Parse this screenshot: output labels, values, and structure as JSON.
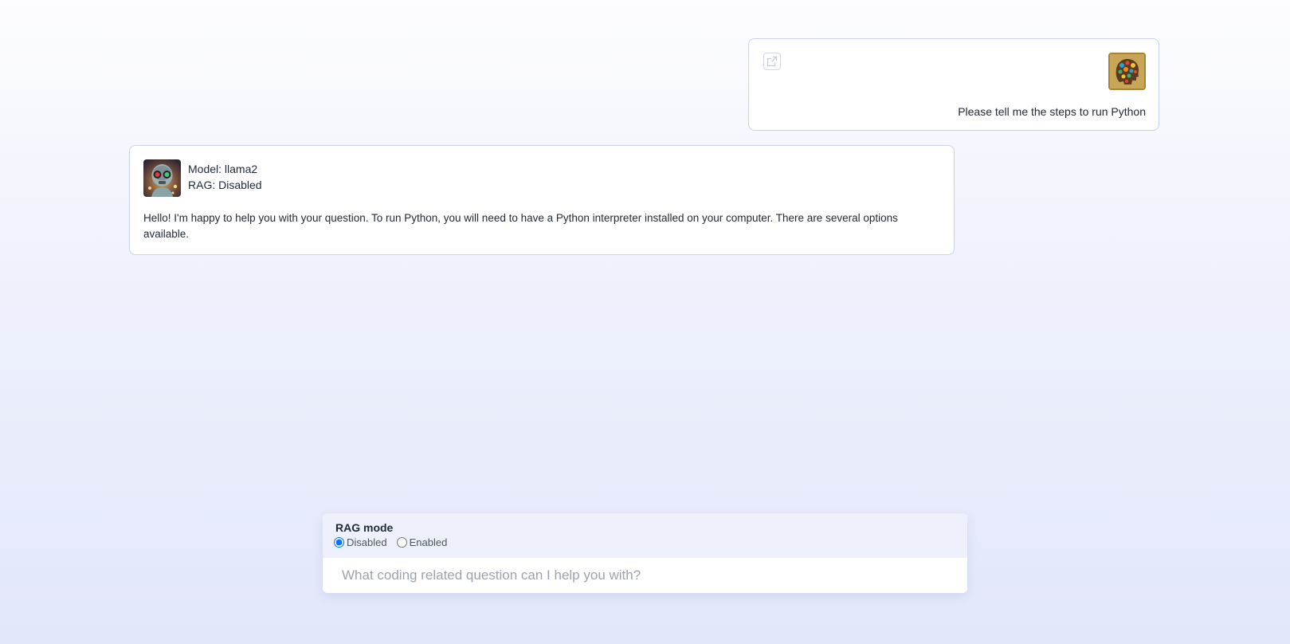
{
  "conversation": {
    "user_message": {
      "text": "Please tell me the steps to run Python",
      "avatar_icon": "brain-mosaic-avatar",
      "share_icon": "external-link-icon"
    },
    "bot_message": {
      "model_line": "Model: llama2",
      "rag_line": "RAG: Disabled",
      "text": "Hello! I'm happy to help you with your question. To run Python, you will need to have a Python interpreter installed on your computer. There are several options available.",
      "avatar_icon": "robot-avatar"
    }
  },
  "input_panel": {
    "rag_mode_label": "RAG mode",
    "options": [
      {
        "label": "Disabled",
        "selected": true
      },
      {
        "label": "Enabled",
        "selected": false
      }
    ],
    "question_placeholder": "What coding related question can I help you with?",
    "question_value": ""
  },
  "colors": {
    "card_border": "#c9d1ee",
    "accent": "#2563eb",
    "background_top": "#fdfdff",
    "background_bottom": "#e2e7fa"
  }
}
